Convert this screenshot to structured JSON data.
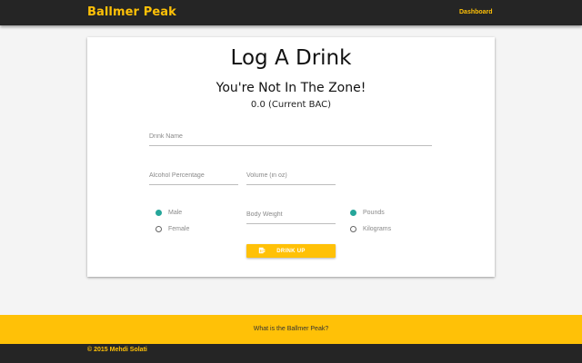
{
  "nav": {
    "brand": "Ballmer Peak",
    "dashboard_label": "Dashboard"
  },
  "form": {
    "title": "Log A Drink",
    "status": "You're Not In The Zone!",
    "bac_text": "0.0 (Current BAC)",
    "drink_name": {
      "placeholder": "Drink Name",
      "value": ""
    },
    "alcohol_percentage": {
      "placeholder": "Alcohol Percentage",
      "value": ""
    },
    "volume": {
      "placeholder": "Volume (in oz)",
      "value": ""
    },
    "body_weight": {
      "placeholder": "Body Weight",
      "value": ""
    },
    "gender": {
      "options": [
        "Male",
        "Female"
      ],
      "selected": "Male"
    },
    "weight_unit": {
      "options": [
        "Pounds",
        "Kilograms"
      ],
      "selected": "Pounds"
    },
    "submit": {
      "label": "DRINK UP",
      "icon": "beer-mug-icon"
    }
  },
  "footer": {
    "link_text": "What is the Ballmer Peak?",
    "copyright": "© 2015 Mehdi Solati"
  },
  "colors": {
    "accent": "#ffc107",
    "nav_bg": "#252525",
    "radio_selected": "#26a69a"
  }
}
